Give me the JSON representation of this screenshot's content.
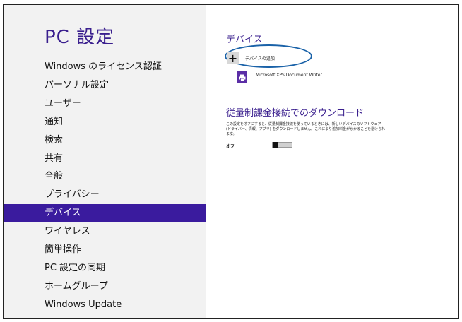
{
  "sidebar": {
    "title": "PC 設定",
    "items": [
      {
        "label": "Windows のライセンス認証"
      },
      {
        "label": "パーソナル設定"
      },
      {
        "label": "ユーザー"
      },
      {
        "label": "通知"
      },
      {
        "label": "検索"
      },
      {
        "label": "共有"
      },
      {
        "label": "全般"
      },
      {
        "label": "プライバシー"
      },
      {
        "label": "デバイス",
        "selected": true
      },
      {
        "label": "ワイヤレス"
      },
      {
        "label": "簡単操作"
      },
      {
        "label": "PC 設定の同期"
      },
      {
        "label": "ホームグループ"
      },
      {
        "label": "Windows Update"
      }
    ]
  },
  "main": {
    "devices_heading": "デバイス",
    "add_device": {
      "icon": "plus-icon",
      "label": "デバイスの追加"
    },
    "devices": [
      {
        "icon": "printer-icon",
        "label": "Microsoft XPS Document Writer"
      }
    ],
    "metered": {
      "heading": "従量制課金接続でのダウンロード",
      "description": [
        "この設定をオフにすると、従量制課金接続を使っているときには、新しいデバイスのソフトウェア",
        "(ドライバー、情報、アプリ) をダウンロードしません。これにより追加料金がかかることを避けられ",
        "ます。"
      ],
      "toggle_state": "オフ"
    }
  },
  "colors": {
    "accent": "#3a1b9e",
    "title": "#3a1f8e",
    "sidebar_bg": "#f2f2f2",
    "highlight_oval": "#1a62a8"
  }
}
